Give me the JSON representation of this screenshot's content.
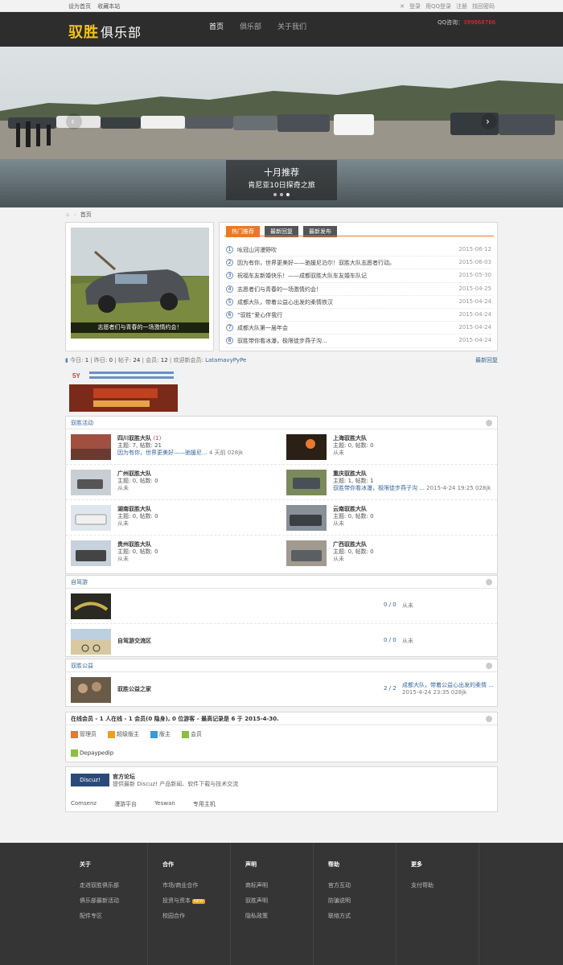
{
  "topbar": {
    "set_home": "设为首页",
    "bookmark": "收藏本站",
    "login": "登录",
    "qq_login": "用QQ登录",
    "register": "注册",
    "forgot": "找回密码"
  },
  "header": {
    "logo_a": "驭胜",
    "logo_b": "俱乐部",
    "nav": [
      "首页",
      "俱乐部",
      "关于我们"
    ],
    "qq_label": "QQ咨询：",
    "qq_number": "399868766"
  },
  "banner": {
    "title": "十月推荐",
    "subtitle": "肯尼亚10日探奇之旅"
  },
  "breadcrumb": "首页",
  "featured": {
    "caption": "志愿者们与青春的一场激情约会！"
  },
  "tabs": [
    "热门推荐",
    "最新回复",
    "最新发布"
  ],
  "news": [
    {
      "num": "1",
      "title": "吆冠山河漫野吹",
      "date": "2015-06-12"
    },
    {
      "num": "2",
      "title": "因为有你，世界更美好——驰援尼泊尔！驭胜大队志愿者行动。",
      "date": "2015-06-03"
    },
    {
      "num": "3",
      "title": "祝福车友新婚快乐！——成都驭胜大队车友婚车队记",
      "date": "2015-05-30"
    },
    {
      "num": "4",
      "title": "志愿者们与青春的一场激情约会！",
      "date": "2015-04-25"
    },
    {
      "num": "5",
      "title": "成都大队，带着公益心出发的柔情铁汉",
      "date": "2015-04-24"
    },
    {
      "num": "6",
      "title": "“驭胜”爱心伴我行",
      "date": "2015-04-24"
    },
    {
      "num": "7",
      "title": "成都大队第一届年会",
      "date": "2015-04-24"
    },
    {
      "num": "8",
      "title": "驭胜带你看冰瀑，极限徒步燕子沟...",
      "date": "2015-04-24"
    }
  ],
  "stats": {
    "today_l": "今日: ",
    "today": "1",
    "yest_l": "昨日: ",
    "yest": "0",
    "posts_l": "帖子: ",
    "posts": "24",
    "members_l": "会员: ",
    "members": "12",
    "newmem_l": "欢迎新会员: ",
    "newmem": "LatamavyPyPe",
    "latest": "最新回复"
  },
  "sections": {
    "activity": "驭胜活动",
    "selfdrive": "自驾游",
    "charity": "驭胜公益"
  },
  "forums_activity": [
    {
      "name": "四川驭胜大队",
      "new": "(1)",
      "stats": "主题: 7, 帖数: 21",
      "last": "因为有你，世界更美好——驰援尼...",
      "last_time": "4 天前",
      "last_user": "028jk"
    },
    {
      "name": "上海驭胜大队",
      "new": "",
      "stats": "主题: 0, 帖数: 0",
      "last": "从未",
      "last_time": "",
      "last_user": ""
    },
    {
      "name": "广州驭胜大队",
      "new": "",
      "stats": "主题: 0, 帖数: 0",
      "last": "从未",
      "last_time": "",
      "last_user": ""
    },
    {
      "name": "重庆驭胜大队",
      "new": "",
      "stats": "主题: 1, 帖数: 1",
      "last": "驭胜带你看冰瀑，极限徒步燕子沟 ...",
      "last_time": "2015-4-24 19:25",
      "last_user": "028jk"
    },
    {
      "name": "湖南驭胜大队",
      "new": "",
      "stats": "主题: 0, 帖数: 0",
      "last": "从未",
      "last_time": "",
      "last_user": ""
    },
    {
      "name": "云南驭胜大队",
      "new": "",
      "stats": "主题: 0, 帖数: 0",
      "last": "从未",
      "last_time": "",
      "last_user": ""
    },
    {
      "name": "贵州驭胜大队",
      "new": "",
      "stats": "主题: 0, 帖数: 0",
      "last": "从未",
      "last_time": "",
      "last_user": ""
    },
    {
      "name": "广西驭胜大队",
      "new": "",
      "stats": "主题: 0, 帖数: 0",
      "last": "从未",
      "last_time": "",
      "last_user": ""
    }
  ],
  "forums_selfdrive": [
    {
      "name": "",
      "count": "0 / 0",
      "last": "从未"
    },
    {
      "name": "自驾游交流区",
      "count": "0 / 0",
      "last": "从未"
    }
  ],
  "forums_charity": [
    {
      "name": "驭胜公益之家",
      "count": "2 / 2",
      "last": "成都大队，带着公益心出发的柔情 ...",
      "last_time": "2015-4-24 23:35",
      "last_user": "028jk"
    }
  ],
  "online": {
    "title": "在线会员 - 1 人在线 - 1 会员(0 隐身), 0 位游客 - 最高记录是 6 于 2015-4-30.",
    "legend": [
      "管理员",
      "超级版主",
      "版主",
      "会员"
    ],
    "user": "Depaypedip"
  },
  "links": {
    "official_name": "官方论坛",
    "official_desc": "提供最新 Discuz! 产品新闻、软件下载与技术交流",
    "logo_text": "Discuz!",
    "items": [
      "Comsenz",
      "漫游平台",
      "Yeswan",
      "专用主机"
    ]
  },
  "footer": [
    {
      "title": "关于",
      "items": [
        "走进驭胜俱乐部",
        "俱乐部最新活动",
        "配件专区"
      ]
    },
    {
      "title": "合作",
      "items": [
        "市场/商业合作",
        "投资与资本",
        "校园合作"
      ],
      "badge": "NEW"
    },
    {
      "title": "声明",
      "items": [
        "商标声明",
        "驭胜声明",
        "隐私政策"
      ]
    },
    {
      "title": "帮助",
      "items": [
        "官方互动",
        "防骗说明",
        "联络方式"
      ]
    },
    {
      "title": "更多",
      "items": [
        "支付帮助"
      ]
    }
  ]
}
